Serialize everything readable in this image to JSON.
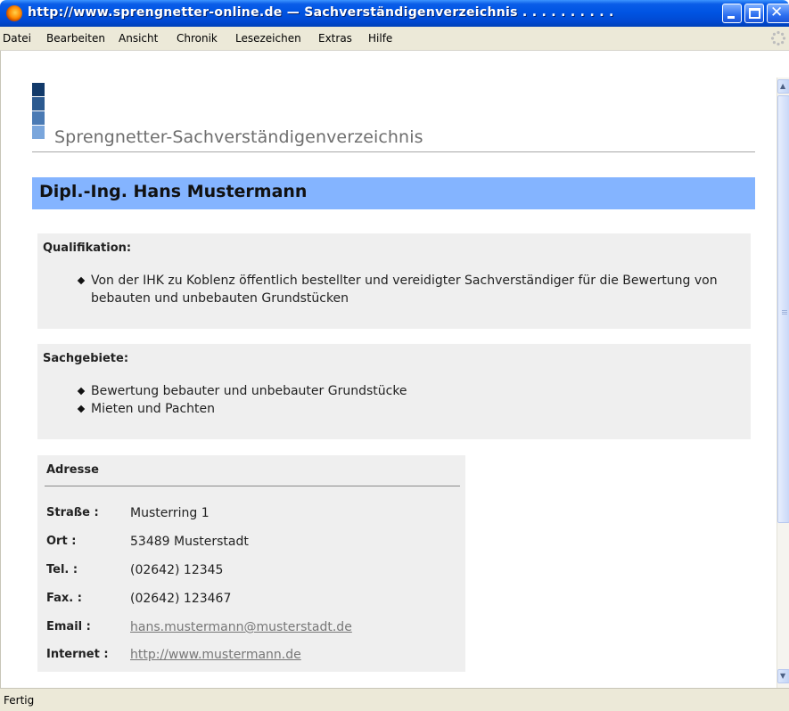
{
  "window": {
    "title": "http://www.sprengnetter-online.de  —  Sachverständigenverzeichnis . . . . . . . . . ."
  },
  "menu": {
    "items": [
      "Datei",
      "Bearbeiten",
      "Ansicht",
      "Chronik",
      "Lesezeichen",
      "Extras",
      "Hilfe"
    ]
  },
  "page": {
    "site_title": "Sprengnetter-Sachverständigenverzeichnis",
    "name": "Dipl.-Ing. Hans Mustermann",
    "qualification": {
      "title": "Qualifikation:",
      "items": [
        "Von der IHK zu Koblenz öffentlich bestellter und vereidigter Sachverständiger für die Bewertung von bebauten und unbebauten Grundstücken"
      ]
    },
    "areas": {
      "title": "Sachgebiete:",
      "items": [
        "Bewertung bebauter und unbebauter Grundstücke",
        "Mieten und Pachten"
      ]
    },
    "address": {
      "title": "Adresse",
      "rows": [
        {
          "label": "Straße :",
          "value": "Musterring 1"
        },
        {
          "label": "Ort :",
          "value": "53489 Musterstadt"
        },
        {
          "label": "Tel. :",
          "value": "(02642) 12345"
        },
        {
          "label": "Fax. :",
          "value": "(02642) 123467"
        },
        {
          "label": "Email :",
          "value": "hans.mustermann@musterstadt.de"
        },
        {
          "label": "Internet :",
          "value": "http://www.mustermann.de"
        }
      ]
    }
  },
  "status": {
    "text": "Fertig"
  },
  "colors": {
    "name_bar": "#84b4ff",
    "panel_bg": "#efefef",
    "logo_blocks": [
      "#123a6a",
      "#2c5a90",
      "#4a7ab4",
      "#7aa6dc"
    ]
  },
  "icons": [
    "firefox-icon",
    "minimize-icon",
    "maximize-icon",
    "close-icon",
    "throbber-icon",
    "scroll-up-icon",
    "scroll-down-icon",
    "bullet-icon"
  ]
}
